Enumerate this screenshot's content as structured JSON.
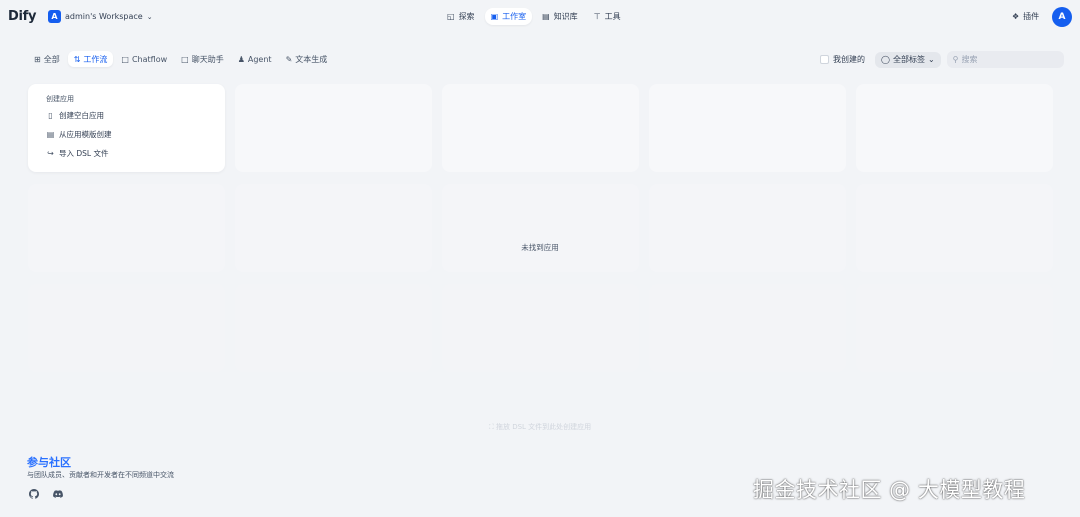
{
  "header": {
    "logo": "Dify",
    "workspace_avatar": "A",
    "workspace_name": "admin's Workspace",
    "nav": [
      {
        "label": "探索",
        "icon": "compass-icon",
        "active": false
      },
      {
        "label": "工作室",
        "icon": "robot-icon",
        "active": true
      },
      {
        "label": "知识库",
        "icon": "book-icon",
        "active": false
      },
      {
        "label": "工具",
        "icon": "hammer-icon",
        "active": false
      }
    ],
    "plugins_label": "插件",
    "user_avatar": "A"
  },
  "filters": {
    "tabs": [
      {
        "label": "全部",
        "icon": "grid-icon",
        "active": false
      },
      {
        "label": "工作流",
        "icon": "workflow-icon",
        "active": true
      },
      {
        "label": "Chatflow",
        "icon": "chatflow-icon",
        "active": false
      },
      {
        "label": "聊天助手",
        "icon": "chat-icon",
        "active": false
      },
      {
        "label": "Agent",
        "icon": "agent-icon",
        "active": false
      },
      {
        "label": "文本生成",
        "icon": "text-gen-icon",
        "active": false
      }
    ],
    "mine_label": "我创建的",
    "tag_label": "全部标签",
    "search_placeholder": "搜索"
  },
  "create_card": {
    "title": "创建应用",
    "items": [
      {
        "label": "创建空白应用",
        "icon": "file-icon"
      },
      {
        "label": "从应用模版创建",
        "icon": "template-icon"
      },
      {
        "label": "导入 DSL 文件",
        "icon": "import-icon"
      }
    ]
  },
  "empty_text": "未找到应用",
  "dsl_hint": "拖放 DSL 文件到此处创建应用",
  "footer": {
    "title": "参与社区",
    "desc": "与团队成员、贡献者和开发者在不同频道中交流"
  },
  "watermark": "掘金技术社区 @ 大模型教程",
  "colors": {
    "accent": "#155eef",
    "background": "#f2f4f7"
  }
}
